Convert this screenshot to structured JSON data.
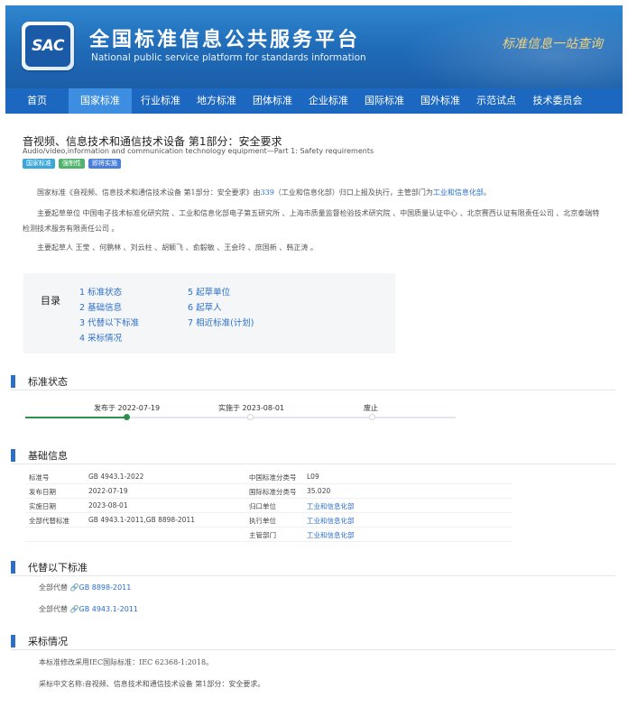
{
  "header": {
    "logo_text": "SAC",
    "title": "全国标准信息公共服务平台",
    "subtitle": "National public service platform  for standards information",
    "slogan": "标准信息一站查询"
  },
  "nav": {
    "items": [
      {
        "label": "首页",
        "active": false
      },
      {
        "label": "国家标准",
        "active": true
      },
      {
        "label": "行业标准",
        "active": false
      },
      {
        "label": "地方标准",
        "active": false
      },
      {
        "label": "团体标准",
        "active": false
      },
      {
        "label": "企业标准",
        "active": false
      },
      {
        "label": "国际标准",
        "active": false
      },
      {
        "label": "国外标准",
        "active": false
      },
      {
        "label": "示范试点",
        "active": false
      },
      {
        "label": "技术委员会",
        "active": false
      }
    ]
  },
  "standard": {
    "title": "音视频、信息技术和通信技术设备 第1部分：安全要求",
    "title_en": "Audio/video,information and communication technology equipment—Part 1: Safety requirements",
    "tags": [
      {
        "label": "国家标准",
        "color": "#3aa5d8"
      },
      {
        "label": "强制性",
        "color": "#4fb36c"
      },
      {
        "label": "即将实施",
        "color": "#4a7fd8"
      }
    ]
  },
  "intro": {
    "p1_a": "国家标准《音视频、信息技术和通信技术设备 第1部分：安全要求》由",
    "p1_tc": "339",
    "p1_b": "（工业和信息化部）归口上报及执行，主管部门为",
    "p1_dept": "工业和信息化部",
    "p1_c": "。",
    "p2": "主要起草单位 中国电子技术标准化研究院 、工业和信息化部电子第五研究所 、上海市质量监督检验技术研究院 、中国质量认证中心 、北京赛西认证有限责任公司 、北京泰瑞特检测技术服务有限责任公司 。",
    "p3": "主要起草人 王莹 、何鹏林 、刘云柱 、胡颖飞 、俞毅敏 、王会玲 、庶国新 、韩正涛 。"
  },
  "toc": {
    "label": "目录",
    "items": [
      "1  标准状态",
      "2  基础信息",
      "3  代替以下标准",
      "4  采标情况",
      "5  起草单位",
      "6  起草人",
      "7  相近标准(计划)"
    ]
  },
  "status_section": {
    "title": "标准状态",
    "publish": "发布于 2022-07-19",
    "implement": "实施于 2023-08-01",
    "abolish": "废止",
    "progress": 0.33
  },
  "basic_section": {
    "title": "基础信息",
    "left": [
      {
        "label": "标准号",
        "value": "GB 4943.1-2022"
      },
      {
        "label": "发布日期",
        "value": "2022-07-19"
      },
      {
        "label": "实施日期",
        "value": "2023-08-01"
      },
      {
        "label": "全部代替标准",
        "value": "GB 4943.1-2011,GB 8898-2011"
      }
    ],
    "right": [
      {
        "label": "中国标准分类号",
        "value": "L09"
      },
      {
        "label": "国际标准分类号",
        "value": "35.020"
      },
      {
        "label": "归口单位",
        "value": "工业和信息化部"
      },
      {
        "label": "执行单位",
        "value": "工业和信息化部"
      },
      {
        "label": "主管部门",
        "value": "工业和信息化部"
      }
    ]
  },
  "replace_section": {
    "title": "代替以下标准",
    "items": [
      {
        "prefix": "全部代替",
        "code": "GB 8898-2011"
      },
      {
        "prefix": "全部代替",
        "code": "GB 4943.1-2011"
      }
    ]
  },
  "adopt_section": {
    "title": "采标情况",
    "line1": "本标准修改采用IEC国际标准：IEC 62368-1:2018。",
    "line2": "采标中文名称:音视频、信息技术和通信技术设备 第1部分：安全要求。"
  }
}
